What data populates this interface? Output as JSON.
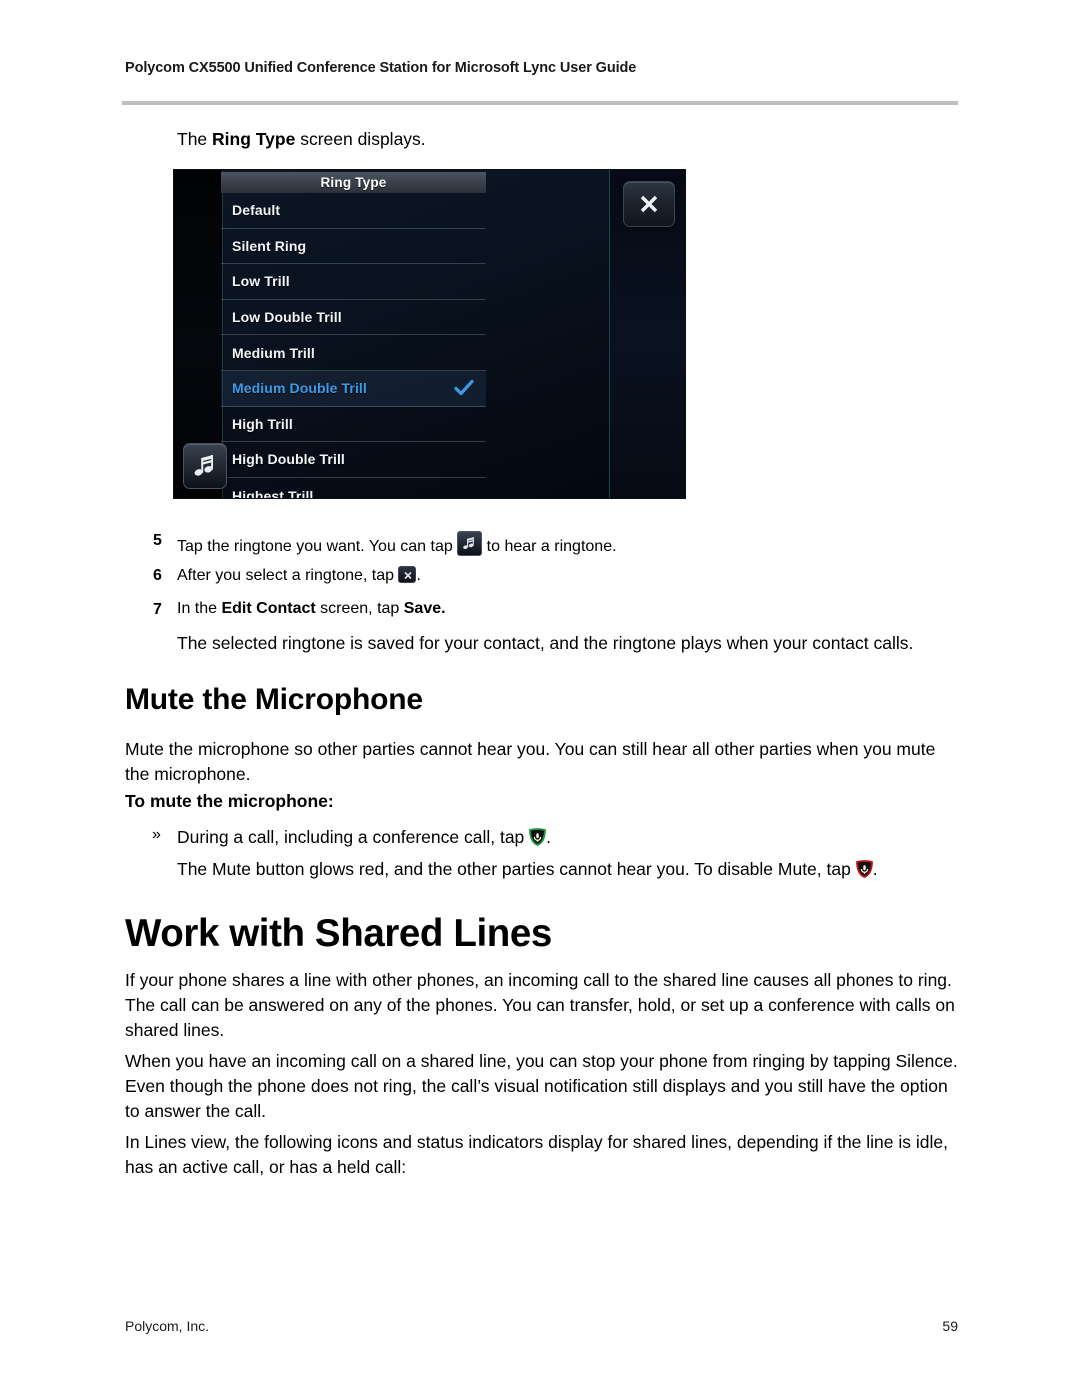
{
  "document": {
    "running_header": "Polycom CX5500 Unified Conference Station for Microsoft Lync User Guide",
    "footer_left": "Polycom, Inc.",
    "page_number": "59"
  },
  "intro": {
    "before": "The ",
    "bold": "Ring Type",
    "after": " screen displays."
  },
  "phone_screenshot": {
    "title": "Ring Type",
    "close_icon": "close-x-icon",
    "note_icon": "music-note-icon",
    "selected_color": "#3d9ae8",
    "check_icon": "checkmark-icon",
    "items": [
      {
        "label": "Default",
        "selected": false
      },
      {
        "label": "Silent Ring",
        "selected": false
      },
      {
        "label": "Low Trill",
        "selected": false
      },
      {
        "label": "Low Double Trill",
        "selected": false
      },
      {
        "label": "Medium Trill",
        "selected": false
      },
      {
        "label": "Medium Double Trill",
        "selected": true
      },
      {
        "label": "High Trill",
        "selected": false
      },
      {
        "label": "High Double Trill",
        "selected": false
      },
      {
        "label": "Highest Trill",
        "selected": false
      }
    ]
  },
  "steps": [
    {
      "number": "5",
      "text_before": "Tap the ringtone you want. You can tap ",
      "icon": "music-note-icon",
      "text_after": " to hear a ringtone."
    },
    {
      "number": "6",
      "text_before": "After you select a ringtone, tap ",
      "icon": "close-x-icon",
      "text_after": "."
    },
    {
      "number": "7",
      "text_before": "In the ",
      "bold_1": "Edit Contact",
      "text_mid": " screen, tap ",
      "bold_2": "Save.",
      "text_after": ""
    }
  ],
  "step_result": "The selected ringtone is saved for your contact, and the ringtone plays when your contact calls.",
  "mute_section": {
    "heading": "Mute the Microphone",
    "intro": "Mute the microphone so other parties cannot hear you. You can still hear all other parties when you mute the microphone.",
    "subheading": "To mute the microphone:",
    "bullet_marker": "»",
    "bullet_before": "During a call, including a conference call, tap ",
    "bullet_icon": "mute-green-icon",
    "bullet_after": ".",
    "result_before": "The Mute button glows red, and the other parties cannot hear you. To disable Mute, tap ",
    "result_icon": "mute-red-icon",
    "result_after": ".",
    "green_color": "#1f9c3c",
    "red_color": "#cc1111"
  },
  "shared_lines_section": {
    "heading": "Work with Shared Lines",
    "paragraph_1": "If your phone shares a line with other phones, an incoming call to the shared line causes all phones to ring. The call can be answered on any of the phones. You can transfer, hold, or set up a conference with calls on shared lines.",
    "paragraph_2": "When you have an incoming call on a shared line, you can stop your phone from ringing by tapping Silence. Even though the phone does not ring, the call’s visual notification still displays and you still have the option to answer the call.",
    "paragraph_3": "In Lines view, the following icons and status indicators display for shared lines, depending if the line is idle, has an active call, or has a held call:"
  }
}
